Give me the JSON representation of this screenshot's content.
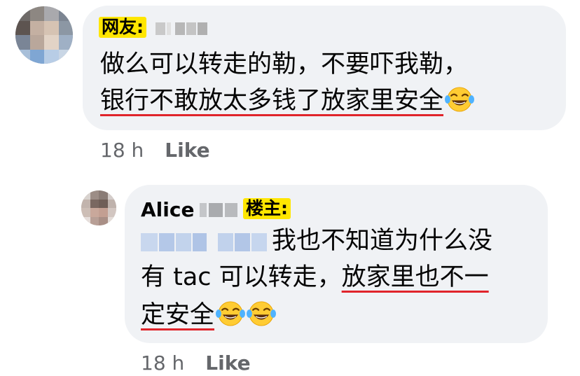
{
  "comment1": {
    "author_tag": "网友:",
    "lines": [
      "做么可以转走的勒，不要吓我勒，",
      "银行不敢放太多钱了放家里安全"
    ],
    "time": "18 h",
    "like_label": "Like"
  },
  "reply": {
    "author_name": "Alice",
    "author_tag": "楼主:",
    "line1": "我也不知道为什么没",
    "line2_plain": "有 tac 可以转走，",
    "line2_underlined": "放家里也不一",
    "line3_underlined": "定安全",
    "time": "18 h",
    "like_label": "Like"
  },
  "colors": {
    "bubble": "#f0f2f5",
    "tag_bg": "#ffe600",
    "underline": "#e0242b",
    "meta_text": "#65676b"
  },
  "icons": {
    "emoji": "face-with-tears-of-joy"
  }
}
